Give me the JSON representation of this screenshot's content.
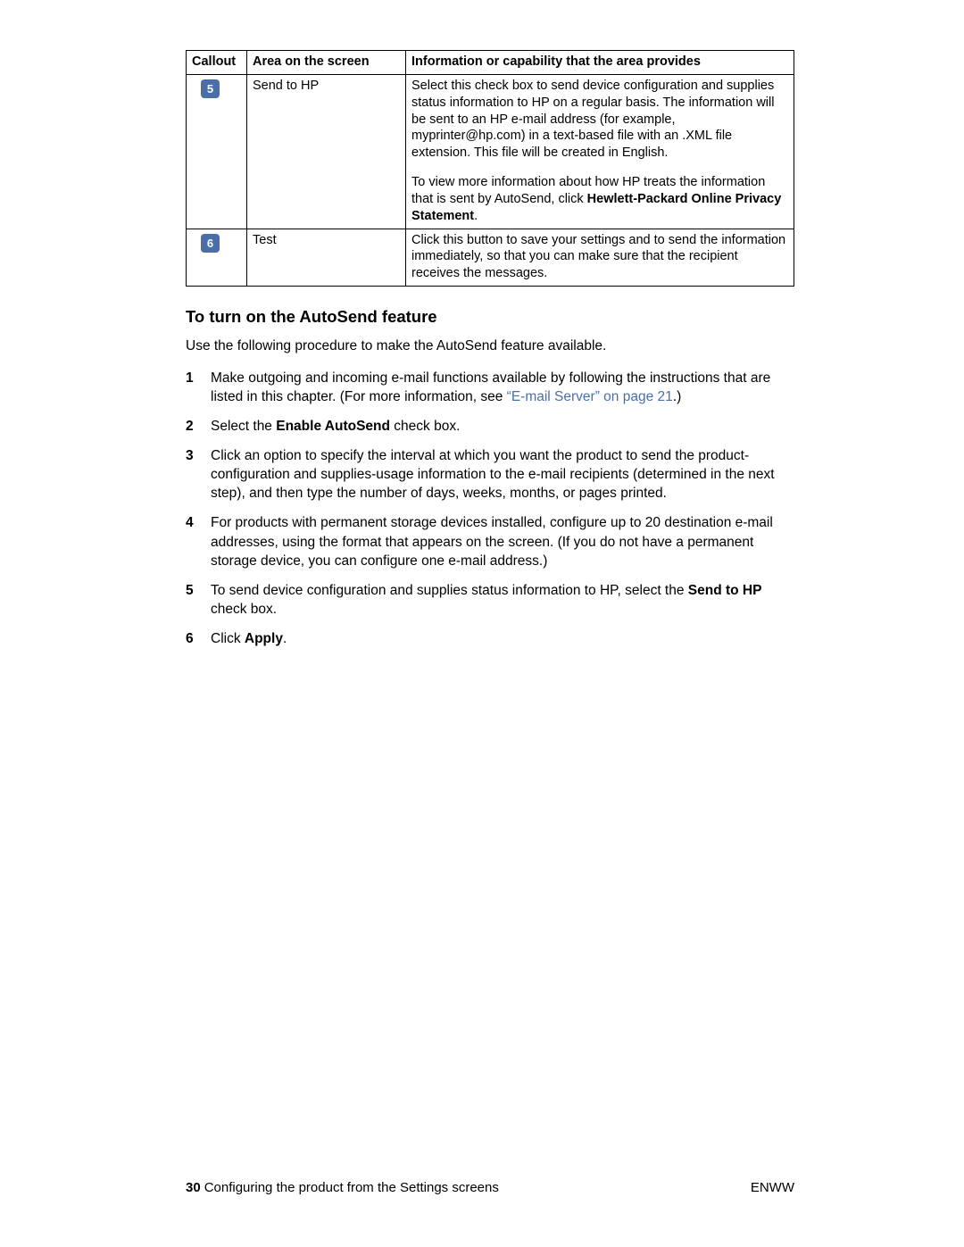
{
  "table": {
    "headers": {
      "callout": "Callout",
      "area": "Area on the screen",
      "info": "Information or capability that the area provides"
    },
    "rows": [
      {
        "badge": "5",
        "area": "Send to HP",
        "info_p1": "Select this check box to send device configuration and supplies status information to HP on a regular basis. The information will be sent to an HP e-mail address (for example, myprinter@hp.com) in a text-based file with an .XML file extension. This file will be created in English.",
        "info_p2_pre": "To view more information about how HP treats the information that is sent by AutoSend, click ",
        "info_p2_bold": "Hewlett-Packard Online Privacy Statement",
        "info_p2_post": "."
      },
      {
        "badge": "6",
        "area": "Test",
        "info_p1": "Click this button to save your settings and to send the information immediately, so that you can make sure that the recipient receives the messages."
      }
    ]
  },
  "section": {
    "heading": "To turn on the AutoSend feature",
    "intro": "Use the following procedure to make the AutoSend feature available.",
    "steps": {
      "s1_pre": "Make outgoing and incoming e-mail functions available by following the instructions that are listed in this chapter. (For more information, see ",
      "s1_link": "“E-mail Server” on page 21",
      "s1_post": ".)",
      "s2_pre": "Select the ",
      "s2_bold": "Enable AutoSend",
      "s2_post": " check box.",
      "s3": "Click an option to specify the interval at which you want the product to send the product-configuration and supplies-usage information to the e-mail recipients (determined in the next step), and then type the number of days, weeks, months, or pages printed.",
      "s4": "For products with permanent storage devices installed, configure up to 20 destination e-mail addresses, using the format that appears on the screen. (If you do not have a permanent storage device, you can configure one e-mail address.)",
      "s5_pre": "To send device configuration and supplies status information to HP, select the ",
      "s5_bold": "Send to HP",
      "s5_post": " check box.",
      "s6_pre": "Click ",
      "s6_bold": "Apply",
      "s6_post": "."
    }
  },
  "footer": {
    "page_num": "30",
    "chapter": "Configuring the product from the Settings screens",
    "lang": "ENWW"
  }
}
